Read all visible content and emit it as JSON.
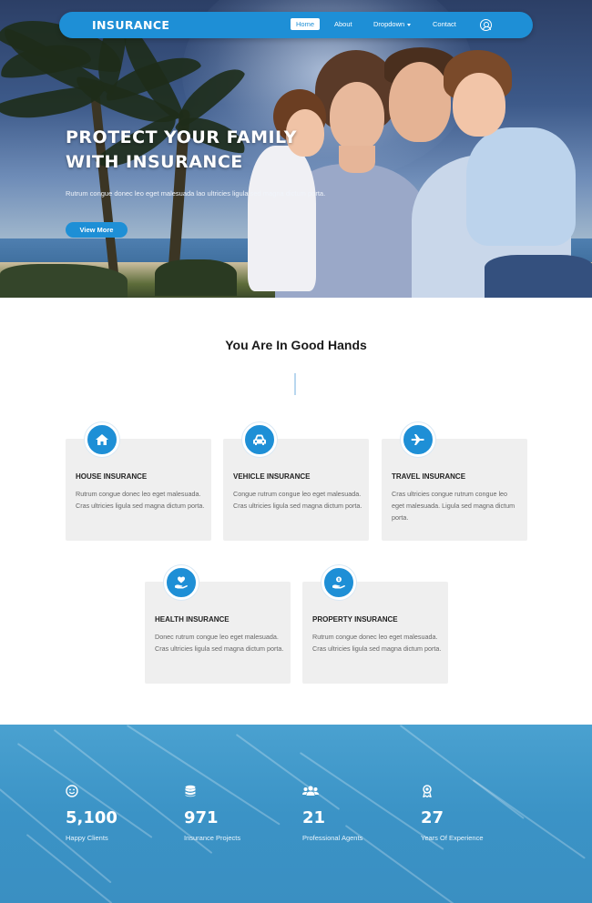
{
  "nav": {
    "brand": "INSURANCE",
    "items": [
      {
        "label": "Home",
        "active": true
      },
      {
        "label": "About"
      },
      {
        "label": "Dropdown"
      },
      {
        "label": "Contact"
      }
    ],
    "user_icon": "user-circle-icon"
  },
  "hero": {
    "title_line1": "PROTECT YOUR FAMILY",
    "title_line2": "WITH INSURANCE",
    "subtitle": "Rutrum congue donec leo eget malesuada lao ultricies ligula sed magna dictum porta.",
    "button": "View More"
  },
  "services": {
    "title": "You Are In Good Hands",
    "cards": [
      {
        "icon": "home-icon",
        "title": "HOUSE INSURANCE",
        "text": "Rutrum congue donec leo eget malesuada. Cras ultricies ligula sed magna dictum porta."
      },
      {
        "icon": "car-icon",
        "title": "VEHICLE INSURANCE",
        "text": "Congue rutrum congue leo eget malesuada. Cras ultricies ligula sed magna dictum porta."
      },
      {
        "icon": "airplane-icon",
        "title": "TRAVEL INSURANCE",
        "text": "Cras ultricies congue rutrum congue leo eget malesuada. Ligula sed magna dictum porta."
      },
      {
        "icon": "heart-hand-icon",
        "title": "HEALTH INSURANCE",
        "text": "Donec rutrum congue leo eget malesuada. Cras ultricies ligula sed magna dictum porta."
      },
      {
        "icon": "money-hand-icon",
        "title": "PROPERTY INSURANCE",
        "text": "Rutrum congue donec leo eget malesuada. Cras ultricies ligula sed magna dictum porta."
      }
    ]
  },
  "stats": [
    {
      "icon": "smile-icon",
      "number": "5,100",
      "label": "Happy Clients"
    },
    {
      "icon": "database-icon",
      "number": "971",
      "label": "Insurance Projects"
    },
    {
      "icon": "users-icon",
      "number": "21",
      "label": "Professional Agents"
    },
    {
      "icon": "award-icon",
      "number": "27",
      "label": "Years Of Experience"
    }
  ],
  "colors": {
    "accent": "#1e8fd6",
    "stats_bg": "#3b93c6",
    "card_bg": "#efefef"
  }
}
